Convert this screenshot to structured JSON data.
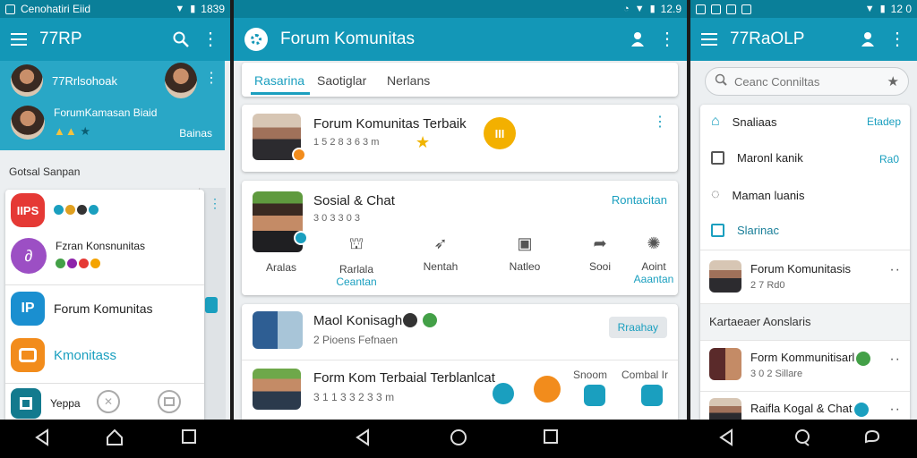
{
  "phone1": {
    "status_left": "Cenohatiri Eiid",
    "status_time": "1839",
    "app_title": "77RP",
    "profile1_name": "77Rrlsohoak",
    "profile2_name": "ForumKamasan Biaid",
    "profile2_sub": "Bainas",
    "section_label": "Gotsal Sanpan",
    "app_badge": "IIPS",
    "item2_label": "Fzran Konsnunitas",
    "item3_label": "Forum Komunitas",
    "item4_label": "Kmonitass",
    "item5_label": "Yeppa"
  },
  "phone2": {
    "status_time": "12.9",
    "app_title": "Forum Komunitas",
    "tabs": [
      "Rasarina",
      "Saotiglar",
      "Nerlans"
    ],
    "card1": {
      "title": "Forum Komunitas Terbaik",
      "sub": "1 5 2 8 3 6 3 m"
    },
    "card2": {
      "title": "Sosial & Chat",
      "sub": "3 0 3 3 0 3",
      "action_link": "Rontacitan",
      "actions": [
        {
          "label": "Aralas",
          "sub": ""
        },
        {
          "label": "Rarlala",
          "sub": "Ceantan"
        },
        {
          "label": "Nentah",
          "sub": ""
        },
        {
          "label": "Natleo",
          "sub": ""
        },
        {
          "label": "Sooi",
          "sub": ""
        },
        {
          "label": "Aoint",
          "sub": "Aaantan"
        }
      ]
    },
    "card3": {
      "title": "Maol Konisagh",
      "sub": "2 Pioens Fefnaen",
      "button": "Rraahay"
    },
    "card4": {
      "title": "Form Kom Terbaial Terblanlcat",
      "sub": "3 1 1 3 3 2 3 3 m",
      "right_label1": "Snoom",
      "right_label2": "Combal Ir"
    }
  },
  "phone3": {
    "status_time": "12 0",
    "app_title": "77RaOLP",
    "search_placeholder": "Ceanc Conniltas",
    "menu": [
      {
        "label": "Snaliaas",
        "right": "Etadep"
      },
      {
        "label": "Maronl kanik",
        "right": "Ra0"
      },
      {
        "label": "Maman luanis",
        "right": ""
      },
      {
        "label": "Slarinac",
        "right": ""
      }
    ],
    "item1_title": "Forum Komunitasis",
    "item1_sub": "2 7 Rd0",
    "section_label": "Kartaeaer Aonslaris",
    "item2_title": "Form Kommunitisarl",
    "item2_sub": "3 0 2 Sillare",
    "item3_title": "Raifla Kogal & Chat"
  }
}
